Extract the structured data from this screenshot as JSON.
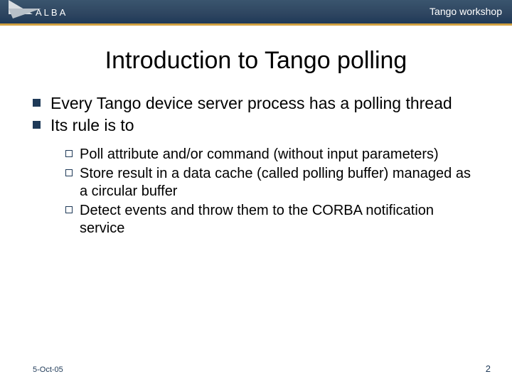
{
  "header": {
    "logo_text": "ALBA",
    "workshop": "Tango workshop"
  },
  "title": "Introduction to Tango polling",
  "bullets": [
    {
      "text": "Every Tango device server process has a polling thread"
    },
    {
      "text": "Its rule is to"
    }
  ],
  "subbullets": [
    {
      "text": "Poll attribute and/or command (without input parameters)"
    },
    {
      "text": "Store result in a data cache (called polling buffer) managed as a circular buffer"
    },
    {
      "text": "Detect events and throw them to the CORBA notification service"
    }
  ],
  "footer": {
    "date": "5-Oct-05",
    "page": "2"
  }
}
